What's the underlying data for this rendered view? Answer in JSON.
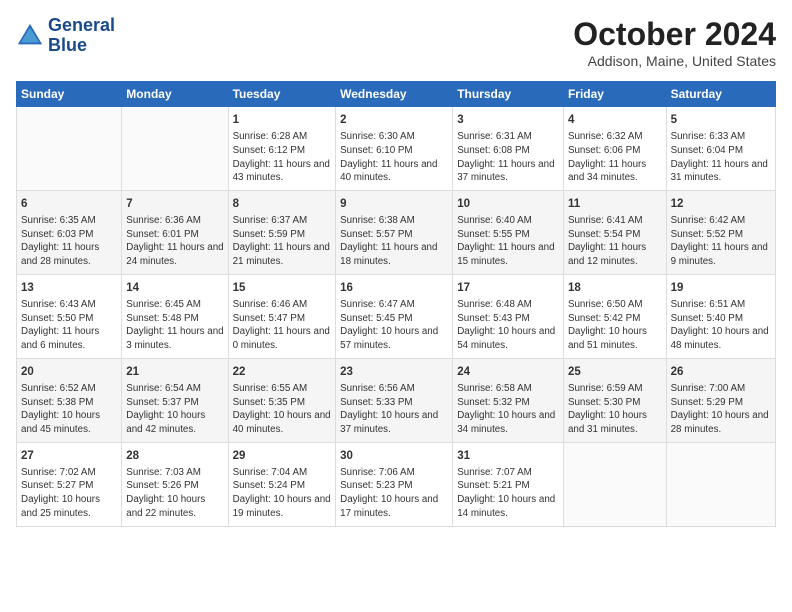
{
  "logo": {
    "line1": "General",
    "line2": "Blue"
  },
  "title": "October 2024",
  "location": "Addison, Maine, United States",
  "days_of_week": [
    "Sunday",
    "Monday",
    "Tuesday",
    "Wednesday",
    "Thursday",
    "Friday",
    "Saturday"
  ],
  "weeks": [
    [
      {
        "day": "",
        "info": ""
      },
      {
        "day": "",
        "info": ""
      },
      {
        "day": "1",
        "info": "Sunrise: 6:28 AM\nSunset: 6:12 PM\nDaylight: 11 hours and 43 minutes."
      },
      {
        "day": "2",
        "info": "Sunrise: 6:30 AM\nSunset: 6:10 PM\nDaylight: 11 hours and 40 minutes."
      },
      {
        "day": "3",
        "info": "Sunrise: 6:31 AM\nSunset: 6:08 PM\nDaylight: 11 hours and 37 minutes."
      },
      {
        "day": "4",
        "info": "Sunrise: 6:32 AM\nSunset: 6:06 PM\nDaylight: 11 hours and 34 minutes."
      },
      {
        "day": "5",
        "info": "Sunrise: 6:33 AM\nSunset: 6:04 PM\nDaylight: 11 hours and 31 minutes."
      }
    ],
    [
      {
        "day": "6",
        "info": "Sunrise: 6:35 AM\nSunset: 6:03 PM\nDaylight: 11 hours and 28 minutes."
      },
      {
        "day": "7",
        "info": "Sunrise: 6:36 AM\nSunset: 6:01 PM\nDaylight: 11 hours and 24 minutes."
      },
      {
        "day": "8",
        "info": "Sunrise: 6:37 AM\nSunset: 5:59 PM\nDaylight: 11 hours and 21 minutes."
      },
      {
        "day": "9",
        "info": "Sunrise: 6:38 AM\nSunset: 5:57 PM\nDaylight: 11 hours and 18 minutes."
      },
      {
        "day": "10",
        "info": "Sunrise: 6:40 AM\nSunset: 5:55 PM\nDaylight: 11 hours and 15 minutes."
      },
      {
        "day": "11",
        "info": "Sunrise: 6:41 AM\nSunset: 5:54 PM\nDaylight: 11 hours and 12 minutes."
      },
      {
        "day": "12",
        "info": "Sunrise: 6:42 AM\nSunset: 5:52 PM\nDaylight: 11 hours and 9 minutes."
      }
    ],
    [
      {
        "day": "13",
        "info": "Sunrise: 6:43 AM\nSunset: 5:50 PM\nDaylight: 11 hours and 6 minutes."
      },
      {
        "day": "14",
        "info": "Sunrise: 6:45 AM\nSunset: 5:48 PM\nDaylight: 11 hours and 3 minutes."
      },
      {
        "day": "15",
        "info": "Sunrise: 6:46 AM\nSunset: 5:47 PM\nDaylight: 11 hours and 0 minutes."
      },
      {
        "day": "16",
        "info": "Sunrise: 6:47 AM\nSunset: 5:45 PM\nDaylight: 10 hours and 57 minutes."
      },
      {
        "day": "17",
        "info": "Sunrise: 6:48 AM\nSunset: 5:43 PM\nDaylight: 10 hours and 54 minutes."
      },
      {
        "day": "18",
        "info": "Sunrise: 6:50 AM\nSunset: 5:42 PM\nDaylight: 10 hours and 51 minutes."
      },
      {
        "day": "19",
        "info": "Sunrise: 6:51 AM\nSunset: 5:40 PM\nDaylight: 10 hours and 48 minutes."
      }
    ],
    [
      {
        "day": "20",
        "info": "Sunrise: 6:52 AM\nSunset: 5:38 PM\nDaylight: 10 hours and 45 minutes."
      },
      {
        "day": "21",
        "info": "Sunrise: 6:54 AM\nSunset: 5:37 PM\nDaylight: 10 hours and 42 minutes."
      },
      {
        "day": "22",
        "info": "Sunrise: 6:55 AM\nSunset: 5:35 PM\nDaylight: 10 hours and 40 minutes."
      },
      {
        "day": "23",
        "info": "Sunrise: 6:56 AM\nSunset: 5:33 PM\nDaylight: 10 hours and 37 minutes."
      },
      {
        "day": "24",
        "info": "Sunrise: 6:58 AM\nSunset: 5:32 PM\nDaylight: 10 hours and 34 minutes."
      },
      {
        "day": "25",
        "info": "Sunrise: 6:59 AM\nSunset: 5:30 PM\nDaylight: 10 hours and 31 minutes."
      },
      {
        "day": "26",
        "info": "Sunrise: 7:00 AM\nSunset: 5:29 PM\nDaylight: 10 hours and 28 minutes."
      }
    ],
    [
      {
        "day": "27",
        "info": "Sunrise: 7:02 AM\nSunset: 5:27 PM\nDaylight: 10 hours and 25 minutes."
      },
      {
        "day": "28",
        "info": "Sunrise: 7:03 AM\nSunset: 5:26 PM\nDaylight: 10 hours and 22 minutes."
      },
      {
        "day": "29",
        "info": "Sunrise: 7:04 AM\nSunset: 5:24 PM\nDaylight: 10 hours and 19 minutes."
      },
      {
        "day": "30",
        "info": "Sunrise: 7:06 AM\nSunset: 5:23 PM\nDaylight: 10 hours and 17 minutes."
      },
      {
        "day": "31",
        "info": "Sunrise: 7:07 AM\nSunset: 5:21 PM\nDaylight: 10 hours and 14 minutes."
      },
      {
        "day": "",
        "info": ""
      },
      {
        "day": "",
        "info": ""
      }
    ]
  ]
}
